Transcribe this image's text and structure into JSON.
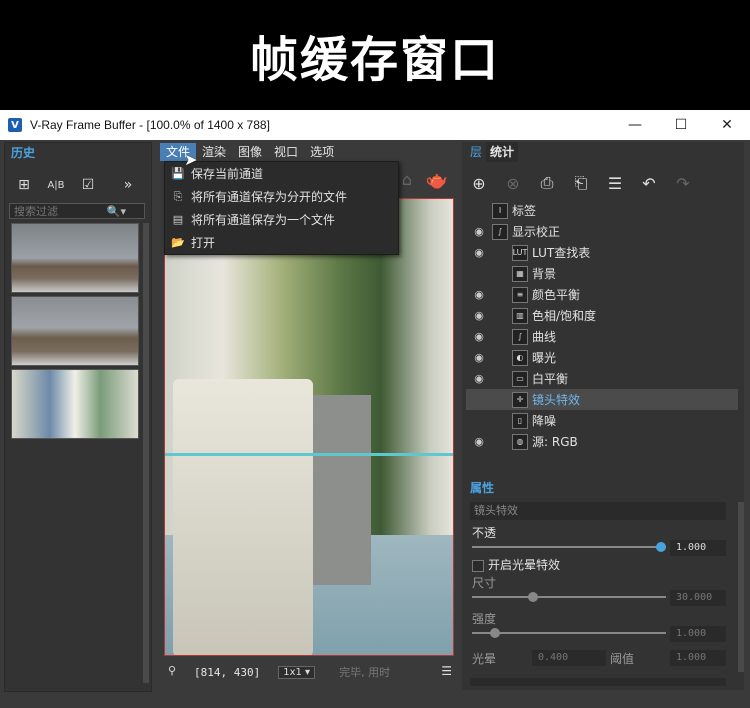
{
  "banner": {
    "title": "帧缓存窗口"
  },
  "window": {
    "title": "V-Ray Frame Buffer - [100.0% of 1400 x 788]",
    "icon_letter": "V",
    "controls": {
      "minimize": "—",
      "maximize": "☐",
      "close": "✕"
    }
  },
  "history": {
    "tab": "历史",
    "search_placeholder": "搜索过滤",
    "tools": {
      "add": "⊞",
      "ab": "A|B",
      "check": "☑",
      "more": "»"
    }
  },
  "menubar": {
    "items": [
      "文件",
      "渲染",
      "图像",
      "视口",
      "选项"
    ]
  },
  "file_menu": {
    "items": [
      {
        "label": "保存当前通道",
        "icon": "💾"
      },
      {
        "label": "将所有通道保存为分开的文件",
        "icon": "⎘"
      },
      {
        "label": "将所有通道保存为一个文件",
        "icon": "▤"
      },
      {
        "label": "打开",
        "icon": "📂"
      }
    ]
  },
  "status": {
    "coords": "[814, 430]",
    "zoom": "1x1 ▾",
    "text": "完毕, 用时"
  },
  "right_panel": {
    "tabs": [
      "层",
      "统计"
    ],
    "layers": [
      {
        "label": "标签",
        "eye": "",
        "icon": "I"
      },
      {
        "label": "显示校正",
        "eye": "◉",
        "icon": "∫"
      },
      {
        "label": "LUT查找表",
        "eye": "◉",
        "icon": "LUT"
      },
      {
        "label": "背景",
        "eye": "",
        "icon": "▦"
      },
      {
        "label": "颜色平衡",
        "eye": "◉",
        "icon": "≡"
      },
      {
        "label": "色相/饱和度",
        "eye": "◉",
        "icon": "▥"
      },
      {
        "label": "曲线",
        "eye": "◉",
        "icon": "∫"
      },
      {
        "label": "曝光",
        "eye": "◉",
        "icon": "◐"
      },
      {
        "label": "白平衡",
        "eye": "◉",
        "icon": "▭"
      },
      {
        "label": "镜头特效",
        "eye": "",
        "icon": "✛"
      },
      {
        "label": "降噪",
        "eye": "",
        "icon": "▯"
      },
      {
        "label": "源: RGB",
        "eye": "◉",
        "icon": "◍"
      }
    ],
    "selected_index": 9,
    "properties": {
      "header": "属性",
      "field": "镜头特效",
      "opacity_label": "不透",
      "opacity_value": "1.000",
      "bloom_label": "开启光晕特效",
      "size_label": "尺寸",
      "size_value": "30.000",
      "intensity_label": "强度",
      "intensity_value": "1.000",
      "light_label": "光晕",
      "light_value": "0.400",
      "threshold_label": "阈值",
      "threshold_value": "1.000"
    }
  },
  "colors": {
    "accent": "#4aa3df",
    "menu_active": "#4a7fb5"
  }
}
